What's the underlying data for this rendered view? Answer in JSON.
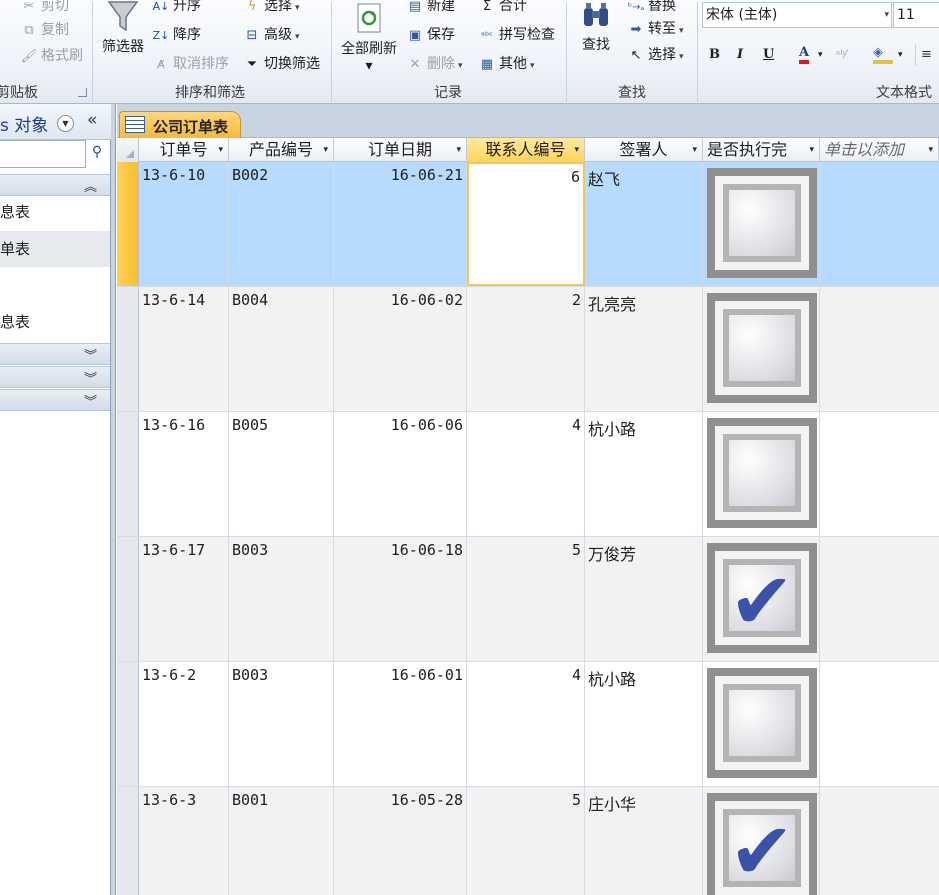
{
  "ribbon": {
    "clipboard": {
      "cut": "剪切",
      "copy": "复制",
      "format_painter": "格式刷",
      "label": "剪贴板"
    },
    "sort_filter": {
      "filter_button": "筛选器",
      "ascending": "升序",
      "descending": "降序",
      "clear_sort": "取消排序",
      "selection": "选择",
      "advanced": "高级",
      "toggle_filter": "切换筛选",
      "label": "排序和筛选"
    },
    "records": {
      "refresh_all": "全部刷新",
      "new": "新建",
      "save": "保存",
      "delete": "删除",
      "totals": "合计",
      "spelling": "拼写检查",
      "more": "其他",
      "label": "记录"
    },
    "find": {
      "find": "查找",
      "replace": "替换",
      "goto": "转至",
      "select": "选择",
      "label": "查找"
    },
    "text_format": {
      "font": "宋体 (主体)",
      "size": "11",
      "bold": "B",
      "italic": "I",
      "underline": "U",
      "font_color_glyph": "A",
      "label": "文本格式"
    }
  },
  "nav": {
    "title": "s 对象",
    "items": [
      {
        "label": "息表"
      },
      {
        "label": "单表"
      },
      {
        "label": "息表"
      }
    ]
  },
  "doc_tab": {
    "title": "公司订单表"
  },
  "table": {
    "columns": [
      "订单号",
      "产品编号",
      "订单日期",
      "联系人编号",
      "签署人",
      "是否执行完",
      "单击以添加"
    ],
    "rows": [
      {
        "order": "13-6-10",
        "product": "B002",
        "date": "16-06-21",
        "contact": "6",
        "signer": "赵飞",
        "done": false
      },
      {
        "order": "13-6-14",
        "product": "B004",
        "date": "16-06-02",
        "contact": "2",
        "signer": "孔亮亮",
        "done": false
      },
      {
        "order": "13-6-16",
        "product": "B005",
        "date": "16-06-06",
        "contact": "4",
        "signer": "杭小路",
        "done": false
      },
      {
        "order": "13-6-17",
        "product": "B003",
        "date": "16-06-18",
        "contact": "5",
        "signer": "万俊芳",
        "done": true
      },
      {
        "order": "13-6-2",
        "product": "B003",
        "date": "16-06-01",
        "contact": "4",
        "signer": "杭小路",
        "done": false
      },
      {
        "order": "13-6-3",
        "product": "B001",
        "date": "16-05-28",
        "contact": "5",
        "signer": "庄小华",
        "done": true
      }
    ]
  },
  "colors": {
    "current_row": "#b7dbff",
    "active_header": "#ffd45a",
    "tab_orange": "#f7b73a",
    "checkbox_mark": "#3a52a8"
  }
}
